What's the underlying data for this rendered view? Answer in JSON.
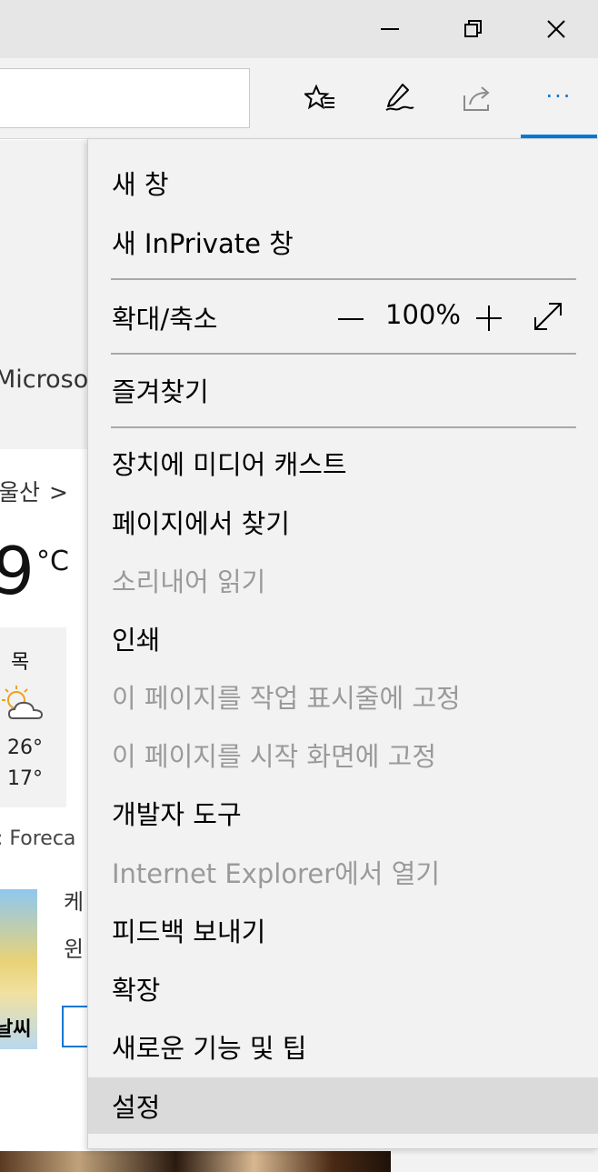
{
  "window": {
    "minimize_icon": "minimize-icon",
    "restore_icon": "restore-icon",
    "close_icon": "close-icon"
  },
  "toolbar": {
    "favorites_icon": "favorites-list-icon",
    "notes_icon": "web-note-pen-icon",
    "share_icon": "share-icon",
    "more_icon": "more-ellipsis-icon",
    "more_label": "···",
    "accent_color": "#0078d7"
  },
  "page": {
    "microsoft_fragment": "Microso",
    "city": "울산",
    "city_chevron": ">",
    "temperature": "9",
    "temperature_unit": "°C",
    "forecast_day": "목",
    "forecast_high": "26°",
    "forecast_low": "17°",
    "source": ": Foreca",
    "thumb_text": "날씨",
    "headline_fragment_1": "케",
    "headline_fragment_2": "윈"
  },
  "menu": {
    "new_window": "새 창",
    "new_inprivate": "새 InPrivate 창",
    "zoom_label": "확대/축소",
    "zoom_minus": "—",
    "zoom_value": "100%",
    "zoom_plus": "+",
    "favorites": "즐겨찾기",
    "cast": "장치에 미디어 캐스트",
    "find": "페이지에서 찾기",
    "read_aloud": "소리내어 읽기",
    "print": "인쇄",
    "pin_taskbar": "이 페이지를 작업 표시줄에 고정",
    "pin_start": "이 페이지를 시작 화면에 고정",
    "dev_tools": "개발자 도구",
    "open_ie": "Internet Explorer에서 열기",
    "feedback": "피드백 보내기",
    "extensions": "확장",
    "whats_new": "새로운 기능 및 팁",
    "settings": "설정"
  }
}
